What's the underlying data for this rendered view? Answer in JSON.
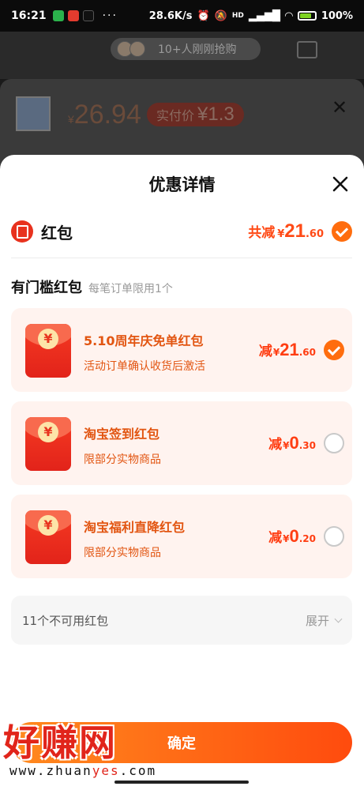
{
  "status_bar": {
    "time": "16:21",
    "more": "···",
    "speed": "28.6K/s",
    "signal": "HD",
    "battery": "100%"
  },
  "background": {
    "pill_text": "10+人刚刚抢购",
    "price_symbol": "¥",
    "price": "26.94",
    "badge_label": "实付价",
    "badge_value": "¥1.3",
    "close_symbol": "✕"
  },
  "sheet": {
    "title": "优惠详情",
    "close_label": "✕",
    "red_packet": {
      "label": "红包",
      "total_prefix": "共减",
      "currency": "¥",
      "total_int": "21",
      "total_dec": ".60",
      "checked": true
    },
    "threshold_section": {
      "title": "有门槛红包",
      "subtitle": "每笔订单限用1个"
    },
    "coupons": [
      {
        "name": "5.10周年庆免单红包",
        "desc": "活动订单确认收货后激活",
        "prefix": "减",
        "currency": "¥",
        "amount_int": "21",
        "amount_dec": ".60",
        "selected": true
      },
      {
        "name": "淘宝签到红包",
        "desc": "限部分实物商品",
        "prefix": "减",
        "currency": "¥",
        "amount_int": "0",
        "amount_dec": ".30",
        "selected": false
      },
      {
        "name": "淘宝福利直降红包",
        "desc": "限部分实物商品",
        "prefix": "减",
        "currency": "¥",
        "amount_int": "0",
        "amount_dec": ".20",
        "selected": false
      }
    ],
    "envelope_symbol": "¥",
    "unavailable": {
      "label": "11个不可用红包",
      "expand_label": "展开"
    },
    "confirm_label": "确定"
  },
  "watermark": {
    "main": "好赚网",
    "url_prefix": "www.zhuan",
    "url_highlight": "yes",
    "url_suffix": ".com"
  },
  "colors": {
    "accent": "#ff6d0e",
    "price_red": "#ff3d12",
    "coupon_bg": "#fff3ef",
    "packet_red": "#e8321e"
  }
}
